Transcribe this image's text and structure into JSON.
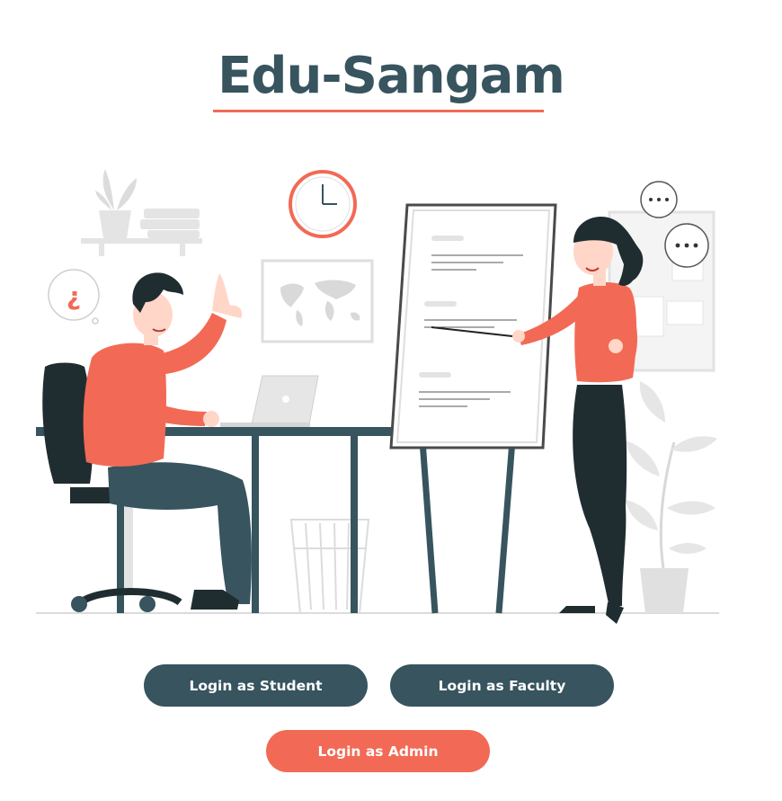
{
  "header": {
    "title": "Edu-Sangam"
  },
  "illustration": {
    "alt": "",
    "colors": {
      "coral": "#f26a55",
      "slate": "#37545f",
      "dark": "#1f2d30",
      "gray": "#e6e6e6"
    }
  },
  "buttons": {
    "student": "Login as Student",
    "faculty": "Login as Faculty",
    "admin": "Login as Admin"
  },
  "colors": {
    "primary": "#37545f",
    "accent": "#f26a55",
    "background": "#ffffff"
  }
}
